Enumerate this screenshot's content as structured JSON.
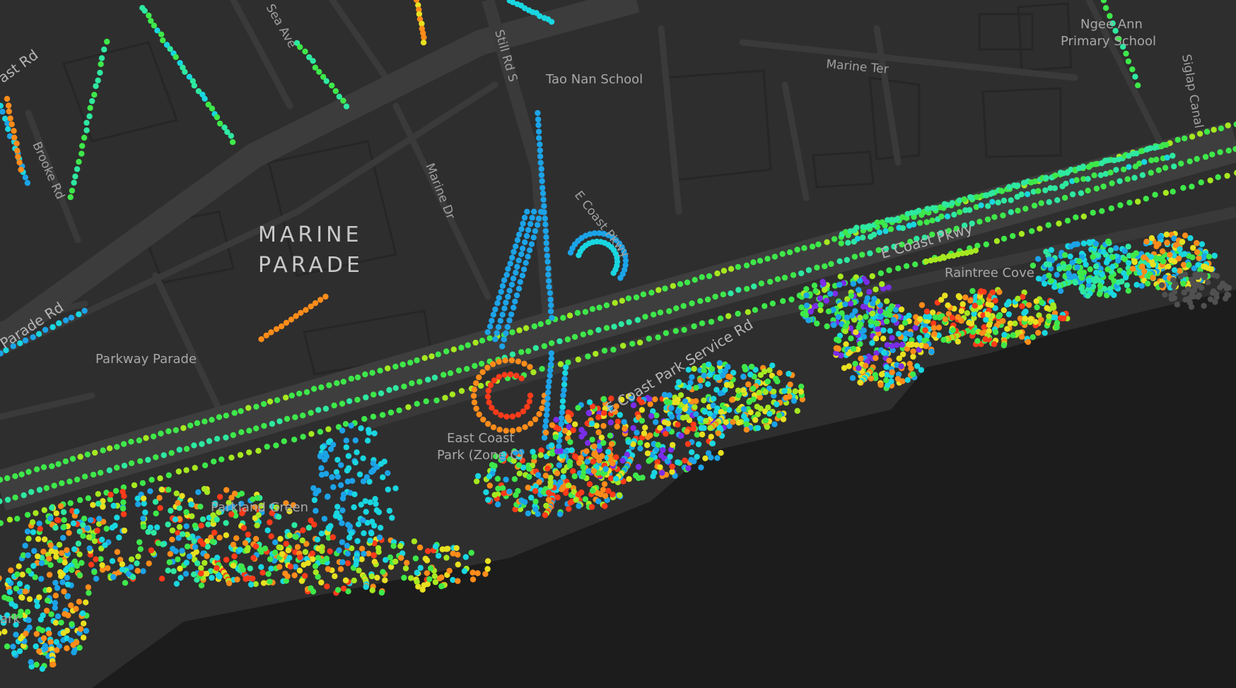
{
  "map": {
    "area_label": {
      "line1": "MARINE",
      "line2": "PARADE"
    },
    "poi": {
      "ngee_ann_1": "Ngee Ann",
      "ngee_ann_2": "Primary School",
      "tao_nan": "Tao Nan School",
      "raintree": "Raintree Cove",
      "parkway_parade": "Parkway Parade",
      "parkland": "Parkland Green",
      "ecp_1": "East Coast",
      "ecp_2": "Park (Zone C)",
      "park_partial": "ark"
    },
    "roads": {
      "marine_ter": "Marine Ter",
      "still_rd": "Still Rd S",
      "marine_dr": "Marine Dr",
      "ecp_small": "E Coast Pkwy",
      "ecp_large": "E Coast Pkwy",
      "service_rd": "E Coast Park Service Rd",
      "parade_rd": "Parade Rd",
      "coast_rd": "ast Rd",
      "brooke_rd": "Brooke Rd",
      "sea_ave": "Sea Ave",
      "siglap_canal": "Siglap Canal"
    },
    "colors": {
      "land": "#2e2e2e",
      "sea": "#1c1c1c",
      "road": "#3a3a3a",
      "building": "#262626",
      "point_palette": [
        "#1ca3e8",
        "#19d6e0",
        "#2ee8a0",
        "#3ee84a",
        "#a6e820",
        "#e8e020",
        "#ff8c1a",
        "#ff3b1a",
        "#7a2de8",
        "#505050"
      ]
    }
  }
}
